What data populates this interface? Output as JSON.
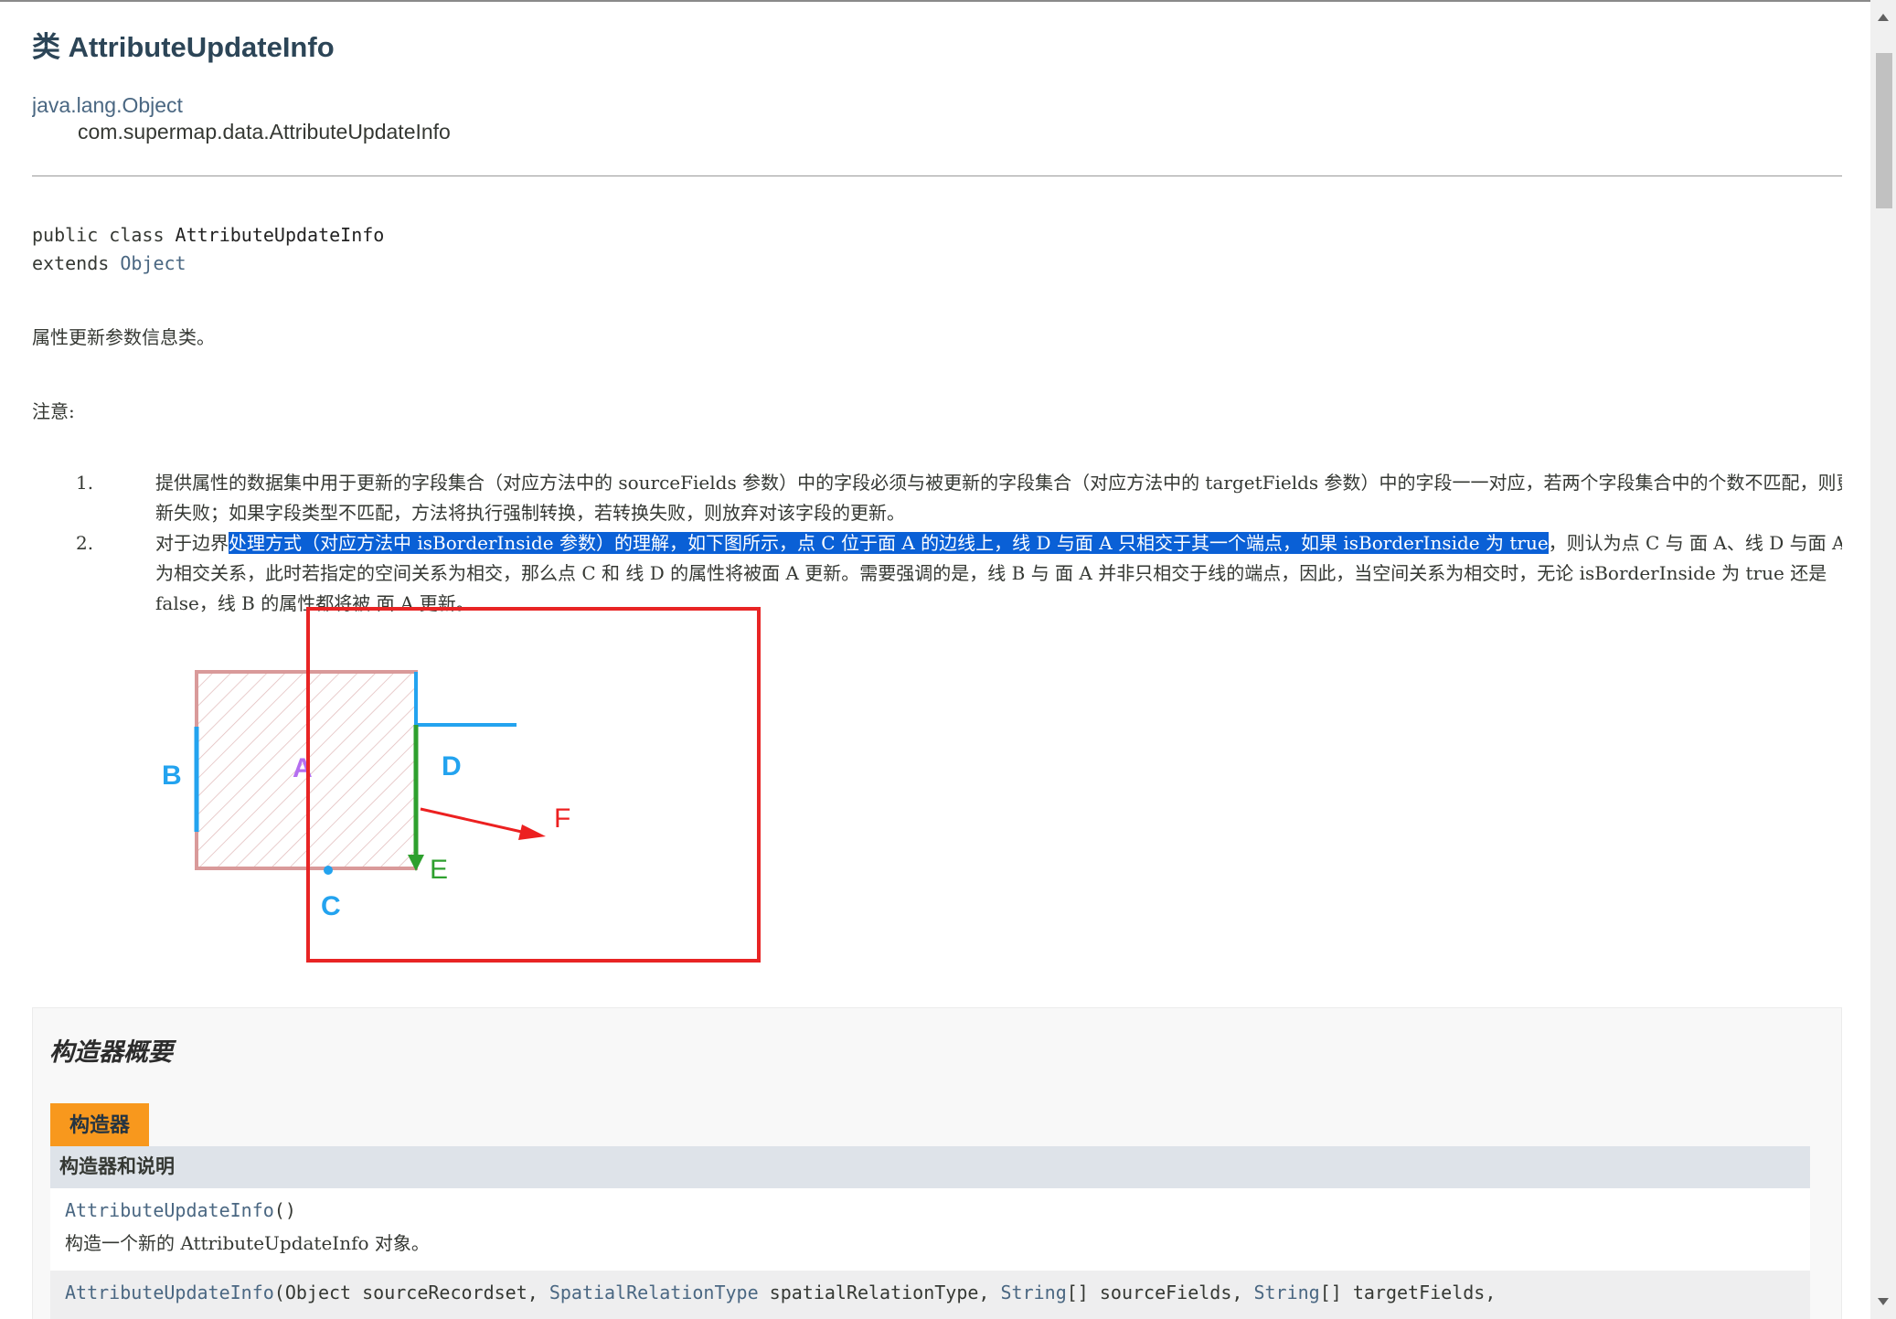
{
  "page": {
    "title": "类 AttributeUpdateInfo",
    "inheritance": [
      "java.lang.Object",
      "com.supermap.data.AttributeUpdateInfo"
    ],
    "declaration": {
      "modifiers": "public class ",
      "class_name": "AttributeUpdateInfo",
      "extends_keyword": "extends ",
      "extends_class": "Object"
    },
    "description": "属性更新参数信息类。",
    "note_label": "注意:",
    "notes": [
      {
        "num": "1.",
        "text": "提供属性的数据集中用于更新的字段集合（对应方法中的 sourceFields 参数）中的字段必须与被更新的字段集合（对应方法中的 targetFields 参数）中的字段一一对应，若两个字段集合中的个数不匹配，则更新失败；如果字段类型不匹配，方法将执行强制转换，若转换失败，则放弃对该字段的更新。"
      },
      {
        "num": "2.",
        "text_before": "对于边界",
        "text_highlight": "处理方式（对应方法中 isBorderInside 参数）的理解，如下图所示，点 C 位于面 A 的边线上，线 D 与面 A 只相交于其一个端点，如果 isBorderInside 为 true",
        "text_after": "，则认为点 C 与 面 A、线 D 与面 A 为相交关系，此时若指定的空间关系为相交，那么点 C 和 线 D 的属性将被面 A 更新。需要强调的是，线 B 与 面 A 并非只相交于线的端点，因此，当空间关系为相交时，无论 isBorderInside 为 true 还是 false，线 B 的属性都将被 面 A 更新。"
      }
    ]
  },
  "diagram": {
    "labels": {
      "a": "A",
      "b": "B",
      "c": "C",
      "d": "D",
      "e": "E",
      "f": "F"
    },
    "colors": {
      "polygon_border": "#d99a9a",
      "hatch": "#e2bcbc",
      "blue": "#23a3ef",
      "purple": "#b56ff0",
      "green": "#2ea02e",
      "red": "#ec2020",
      "annotation_box": "#e82424"
    }
  },
  "summary": {
    "title": "构造器概要",
    "tab_label": "构造器",
    "header": "构造器和说明",
    "rows": [
      {
        "link": "AttributeUpdateInfo",
        "params": "()",
        "desc": "构造一个新的 AttributeUpdateInfo 对象。"
      },
      {
        "link": "AttributeUpdateInfo",
        "open": "(",
        "p1_type": "Object",
        "p1_name": " sourceRecordset, ",
        "p2_type": "SpatialRelationType",
        "p2_name": " spatialRelationType, ",
        "p3_type": "String",
        "p3_name": "[] sourceFields, ",
        "p4_type": "String",
        "p4_name": "[] targetFields,"
      }
    ]
  },
  "scrollbar": {
    "up_icon": "triangle-up",
    "down_icon": "triangle-down"
  }
}
